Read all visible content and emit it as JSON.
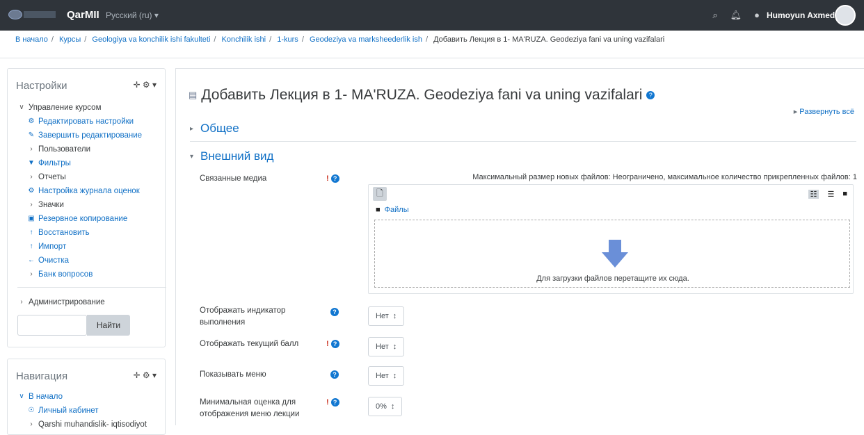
{
  "topbar": {
    "brand": "QarMII",
    "language": "Русский (ru) ▾",
    "user_name": "Humoyun Axmedov"
  },
  "breadcrumb": [
    "В начало",
    "Курсы",
    "Geologiya va konchilik ishi fakulteti",
    "Konchilik ishi",
    "1-kurs",
    "Geodeziya va marksheederlik ish",
    "Добавить Лекция в 1- MA'RUZA. Geodeziya fani va uning vazifalari"
  ],
  "settings_block": {
    "title": "Настройки",
    "course_admin": "Управление курсом",
    "items": [
      "Редактировать настройки",
      "Завершить редактирование",
      "Пользователи",
      "Фильтры",
      "Отчеты",
      "Настройка журнала оценок",
      "Значки",
      "Резервное копирование",
      "Восстановить",
      "Импорт",
      "Очистка",
      "Банк вопросов"
    ],
    "administration": "Администрирование",
    "search_button": "Найти"
  },
  "nav_block": {
    "title": "Навигация",
    "home": "В начало",
    "dashboard": "Личный кабинет",
    "site": "Qarshi muhandislik- iqtisodiyot"
  },
  "main": {
    "title": "Добавить Лекция в 1- MA'RUZA. Geodeziya fani va uning vazifalari",
    "expand_all": "Развернуть всё",
    "section_general": "Общее",
    "section_appearance": "Внешний вид",
    "linked_media_label": "Связанные медиа",
    "max_info": "Максимальный размер новых файлов: Неограничено, максимальное количество прикрепленных файлов: 1",
    "files_label": "Файлы",
    "drop_text": "Для загрузки файлов перетащите их сюда.",
    "progress_label": "Отображать индикатор выполнения",
    "progress_value": "Нет",
    "score_label": "Отображать текущий балл",
    "score_value": "Нет",
    "menu_label": "Показывать меню",
    "menu_value": "Нет",
    "mingrade_label": "Минимальная оценка для отображения меню лекции",
    "mingrade_value": "0%"
  }
}
